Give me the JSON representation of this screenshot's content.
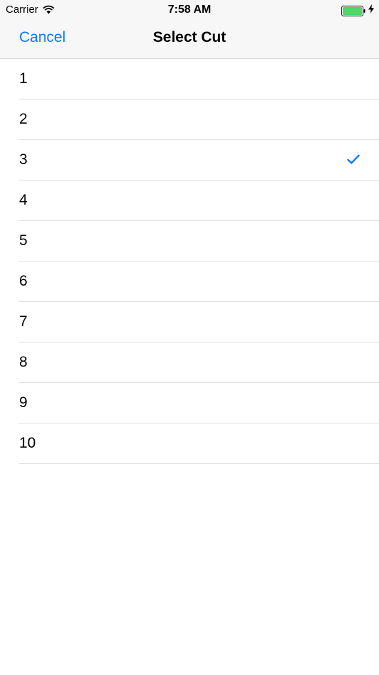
{
  "status_bar": {
    "carrier": "Carrier",
    "time": "7:58 AM"
  },
  "nav": {
    "cancel_label": "Cancel",
    "title": "Select Cut"
  },
  "list": {
    "items": [
      {
        "label": "1",
        "selected": false
      },
      {
        "label": "2",
        "selected": false
      },
      {
        "label": "3",
        "selected": true
      },
      {
        "label": "4",
        "selected": false
      },
      {
        "label": "5",
        "selected": false
      },
      {
        "label": "6",
        "selected": false
      },
      {
        "label": "7",
        "selected": false
      },
      {
        "label": "8",
        "selected": false
      },
      {
        "label": "9",
        "selected": false
      },
      {
        "label": "10",
        "selected": false
      }
    ]
  },
  "colors": {
    "accent": "#0a7aff",
    "battery": "#4cd964"
  },
  "icons": {
    "wifi": "wifi-icon",
    "battery": "battery-icon",
    "charging": "charging-bolt-icon",
    "check": "checkmark-icon"
  }
}
